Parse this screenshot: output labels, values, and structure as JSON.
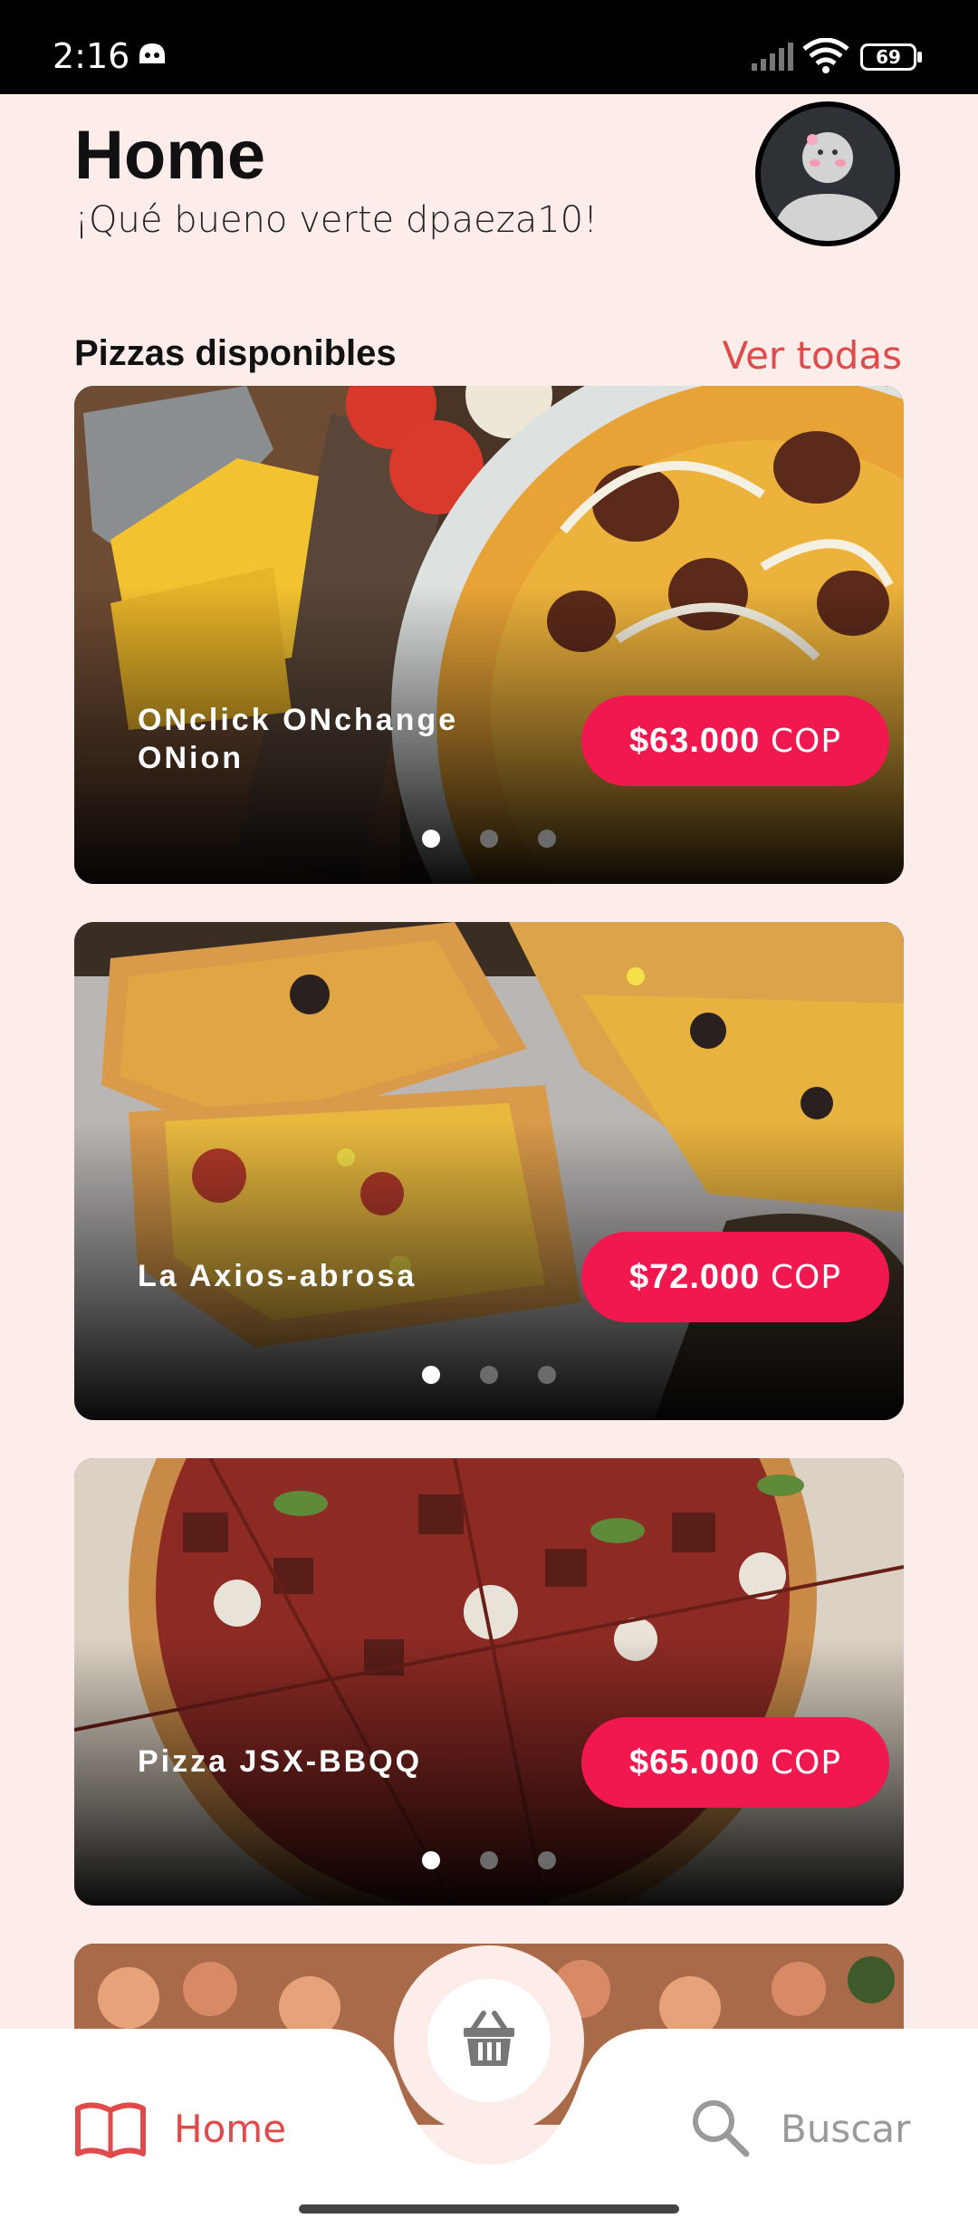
{
  "status_bar": {
    "time": "2:16",
    "battery": "69",
    "icons": [
      "notification-icon",
      "signal-icon",
      "wifi-icon",
      "battery-icon"
    ]
  },
  "header": {
    "title": "Home",
    "greeting": "¡Qué bueno verte dpaeza10!"
  },
  "section": {
    "title": "Pizzas disponibles",
    "see_all": "Ver todas"
  },
  "pizzas": [
    {
      "name": "ONclick ONchange ONion",
      "price": "$63.000",
      "currency": "COP",
      "slide": 1,
      "slides": 3
    },
    {
      "name": "La Axios-abrosa",
      "price": "$72.000",
      "currency": "COP",
      "slide": 1,
      "slides": 3
    },
    {
      "name": "Pizza JSX-BBQQ",
      "price": "$65.000",
      "currency": "COP",
      "slide": 1,
      "slides": 3
    }
  ],
  "nav": {
    "home_label": "Home",
    "search_label": "Buscar",
    "cart_icon": "basket-icon"
  },
  "colors": {
    "background": "#FDEDEA",
    "accent": "#E04A4A",
    "price_pill": "#F0184F"
  }
}
